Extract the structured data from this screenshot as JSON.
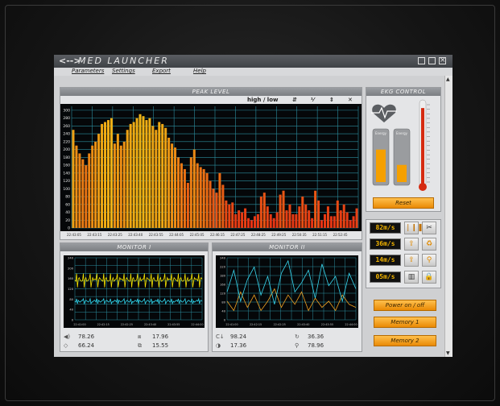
{
  "window": {
    "logo": "<-->",
    "title": "MED LAUNCHER"
  },
  "menu": [
    "Parameters",
    "Settings",
    "Export",
    "Help"
  ],
  "peak": {
    "title": "PEAK LEVEL",
    "toolbar_label": "high / low",
    "toolbar_icons": [
      "⇵",
      "⅟",
      "⇕",
      "✕"
    ],
    "chart_data": {
      "type": "bar",
      "x_ticks": [
        "22:43:05",
        "22:43:15",
        "22:43:25",
        "22:43:40",
        "22:43:55",
        "22:44:05",
        "22:45:05",
        "22:46:15",
        "22:47:25",
        "22:48:25",
        "22:49:25",
        "22:50:35",
        "22:51:15",
        "22:52:45"
      ],
      "y_ticks": [
        0,
        20,
        40,
        60,
        80,
        100,
        120,
        140,
        160,
        180,
        200,
        220,
        240,
        260,
        280,
        300
      ],
      "ylim": [
        0,
        310
      ],
      "values": [
        250,
        210,
        190,
        175,
        160,
        190,
        210,
        220,
        240,
        265,
        270,
        275,
        280,
        215,
        240,
        210,
        220,
        250,
        265,
        270,
        280,
        290,
        285,
        275,
        280,
        260,
        250,
        270,
        265,
        255,
        230,
        215,
        205,
        180,
        165,
        150,
        115,
        180,
        200,
        165,
        155,
        150,
        140,
        120,
        100,
        90,
        140,
        110,
        70,
        60,
        65,
        35,
        45,
        40,
        50,
        25,
        20,
        30,
        35,
        80,
        90,
        55,
        35,
        25,
        40,
        85,
        95,
        45,
        60,
        35,
        35,
        55,
        80,
        60,
        45,
        25,
        95,
        70,
        20,
        35,
        55,
        30,
        30,
        70,
        45,
        60,
        40,
        20,
        30,
        50
      ]
    }
  },
  "monitor1": {
    "title": "MONITOR I",
    "y_ticks": [
      "240",
      "200",
      "160",
      "120",
      "80",
      "40",
      "0"
    ],
    "x_ticks": [
      "22:41:00",
      "22:42:15",
      "22:42:25",
      "22:43:40",
      "22:43:55",
      "22:44:00"
    ],
    "readouts": [
      {
        "icon": "speaker-icon",
        "glyph": "◀)",
        "value": "78.26"
      },
      {
        "icon": "frame-icon",
        "glyph": "⧈",
        "value": "17.96"
      },
      {
        "icon": "diamond-icon",
        "glyph": "◇",
        "value": "66.24"
      },
      {
        "icon": "scan-icon",
        "glyph": "⧉",
        "value": "15.55"
      }
    ]
  },
  "monitor2": {
    "title": "MONITOR II",
    "y_ticks": [
      "240",
      "220",
      "180",
      "160",
      "120",
      "80",
      "40",
      "0"
    ],
    "x_ticks": [
      "22:41:00",
      "22:42:15",
      "22:42:25",
      "22:43:40",
      "22:43:55",
      "22:44:00"
    ],
    "readouts": [
      {
        "icon": "c-arrow-icon",
        "glyph": "C↓",
        "value": "98.24"
      },
      {
        "icon": "refresh-icon",
        "glyph": "↻",
        "value": "36.36"
      },
      {
        "icon": "contrast-icon",
        "glyph": "◑",
        "value": "17.36"
      },
      {
        "icon": "search-icon",
        "glyph": "⚲",
        "value": "78.96"
      }
    ]
  },
  "ekg": {
    "title": "EKG CONTROL",
    "tube_label": "Energy",
    "tube1_level": 0.72,
    "tube2_level": 0.38,
    "thermo_level": 0.93,
    "reset_label": "Reset"
  },
  "speeds": [
    "82m/s",
    "36m/s",
    "14m/s",
    "05m/s"
  ],
  "tool_icons": [
    "equalizer-icon",
    "scissors-icon",
    "upload-icon",
    "recycle-icon",
    "upload-icon",
    "magnifier-icon",
    "barcode-icon",
    "lock-icon"
  ],
  "buttons": {
    "power": "Power on / off",
    "memory1": "Memory 1",
    "memory2": "Memory 2"
  }
}
